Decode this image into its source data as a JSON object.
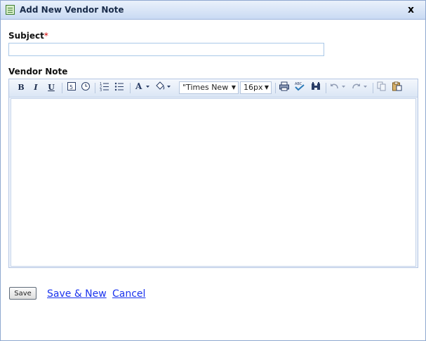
{
  "dialog": {
    "title": "Add New Vendor Note",
    "close_label": "x",
    "icons": {
      "title": "note-icon",
      "close": "close-icon"
    }
  },
  "form": {
    "subject_label": "Subject",
    "required_marker": "*",
    "subject_value": "",
    "vendor_note_label": "Vendor Note"
  },
  "toolbar": {
    "bold": "B",
    "italic": "I",
    "underline": "U",
    "font_family": "\"Times New ...",
    "font_size": "16px",
    "icons": [
      "bold-icon",
      "italic-icon",
      "underline-icon",
      "insert-date-icon",
      "insert-time-icon",
      "ordered-list-icon",
      "unordered-list-icon",
      "font-color-icon",
      "highlight-color-icon",
      "print-icon",
      "spellcheck-icon",
      "find-replace-icon",
      "undo-icon",
      "redo-icon",
      "copy-icon",
      "paste-icon"
    ]
  },
  "actions": {
    "save": "Save",
    "save_new": "Save & New",
    "cancel": "Cancel"
  }
}
